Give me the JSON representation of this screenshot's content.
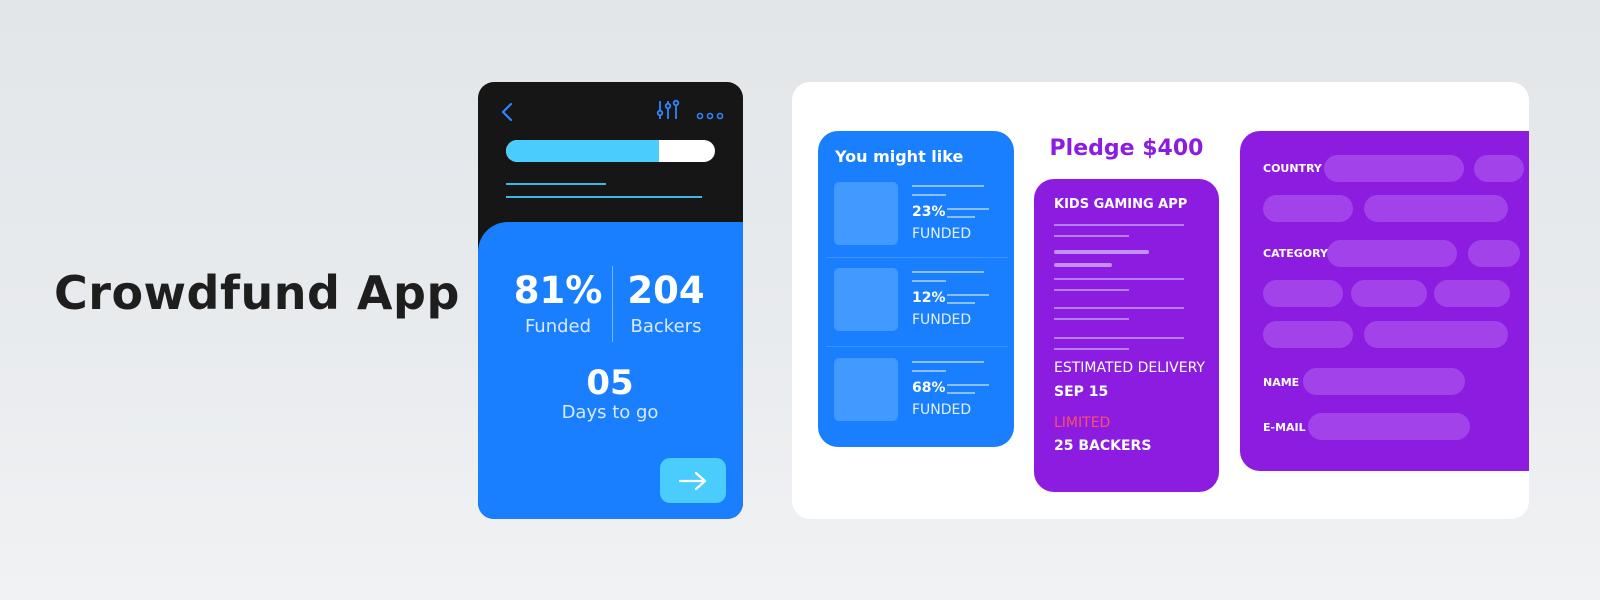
{
  "page": {
    "title": "Crowdfund App"
  },
  "colors": {
    "phone_bg": "#161616",
    "primary_blue": "#197ffe",
    "accent_cyan": "#4acdfd",
    "purple": "#8c1de0",
    "limited_red": "#ff4d6b"
  },
  "phone": {
    "icons": {
      "back": "chevron-left-icon",
      "filter": "sliders-icon",
      "more": "more-dots-icon",
      "next": "arrow-right-icon"
    },
    "progress": 0.73,
    "funded": {
      "value": "81%",
      "label": "Funded"
    },
    "backers": {
      "value": "204",
      "label": "Backers"
    },
    "days": {
      "value": "05",
      "label": "Days to go"
    }
  },
  "recommend": {
    "title": "You might like",
    "items": [
      {
        "percent": "23%",
        "label": "FUNDED"
      },
      {
        "percent": "12%",
        "label": "FUNDED"
      },
      {
        "percent": "68%",
        "label": "FUNDED"
      }
    ]
  },
  "pledge": {
    "title": "Pledge $400",
    "app_name": "KIDS GAMING APP",
    "delivery_label": "ESTIMATED DELIVERY",
    "delivery_date": "SEP 15",
    "limited_label": "LIMITED",
    "backers": "25 BACKERS"
  },
  "form": {
    "country_label": "COUNTRY",
    "category_label": "CATEGORY",
    "name_label": "NAME",
    "email_label": "E-MAIL"
  }
}
